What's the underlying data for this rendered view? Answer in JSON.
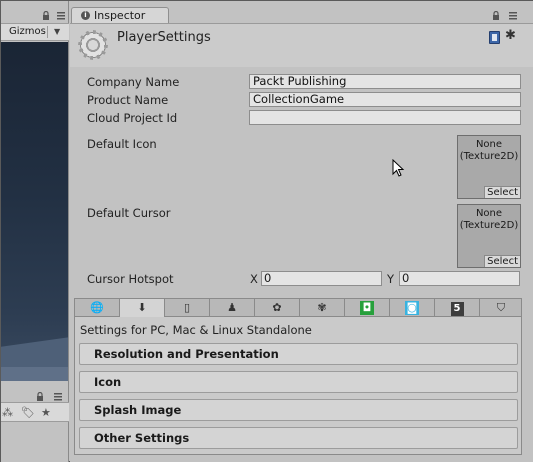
{
  "left_panel": {
    "gizmos_label": "Gizmos",
    "icons": [
      "lock-icon",
      "menu-icon",
      "tag-icon",
      "star-icon"
    ]
  },
  "inspector": {
    "tab_label": "Inspector",
    "title": "PlayerSettings",
    "fields": {
      "company_name_label": "Company Name",
      "company_name_value": "Packt Publishing",
      "product_name_label": "Product Name",
      "product_name_value": "CollectionGame",
      "cloud_project_label": "Cloud Project Id",
      "cloud_project_value": "",
      "default_icon_label": "Default Icon",
      "default_cursor_label": "Default Cursor",
      "texture_none": "None",
      "texture_type": "(Texture2D)",
      "select_label": "Select",
      "cursor_hotspot_label": "Cursor Hotspot",
      "x_label": "X",
      "x_value": "0",
      "y_label": "Y",
      "y_value": "0"
    },
    "platform_tabs": [
      {
        "name": "web-player-icon",
        "glyph": "🌐"
      },
      {
        "name": "standalone-icon",
        "glyph": "⬇"
      },
      {
        "name": "ios-icon",
        "glyph": "▯"
      },
      {
        "name": "android-icon",
        "glyph": "♟"
      },
      {
        "name": "blackberry-icon",
        "glyph": "✿"
      },
      {
        "name": "tizen-icon",
        "glyph": "✾"
      },
      {
        "name": "xbox-icon",
        "glyph": "◘"
      },
      {
        "name": "windows-store-icon",
        "glyph": "◙"
      },
      {
        "name": "webgl-icon",
        "glyph": "5"
      },
      {
        "name": "samsung-tv-icon",
        "glyph": "⛉"
      }
    ],
    "settings_for": "Settings for PC, Mac & Linux Standalone",
    "sections": [
      "Resolution and Presentation",
      "Icon",
      "Splash Image",
      "Other Settings"
    ]
  }
}
